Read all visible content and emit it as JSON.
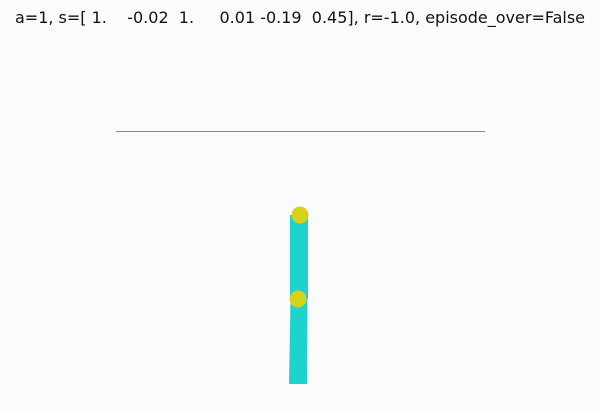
{
  "status": {
    "text": "a=1, s=[ 1.    -0.02  1.     0.01 -0.19  0.45], r=-1.0, episode_over=False"
  },
  "environment": {
    "colors": {
      "background": "#fbfbfd",
      "link": "#1fd3cd",
      "joint": "#d6d119",
      "target_line": "#8a8a8a"
    }
  }
}
